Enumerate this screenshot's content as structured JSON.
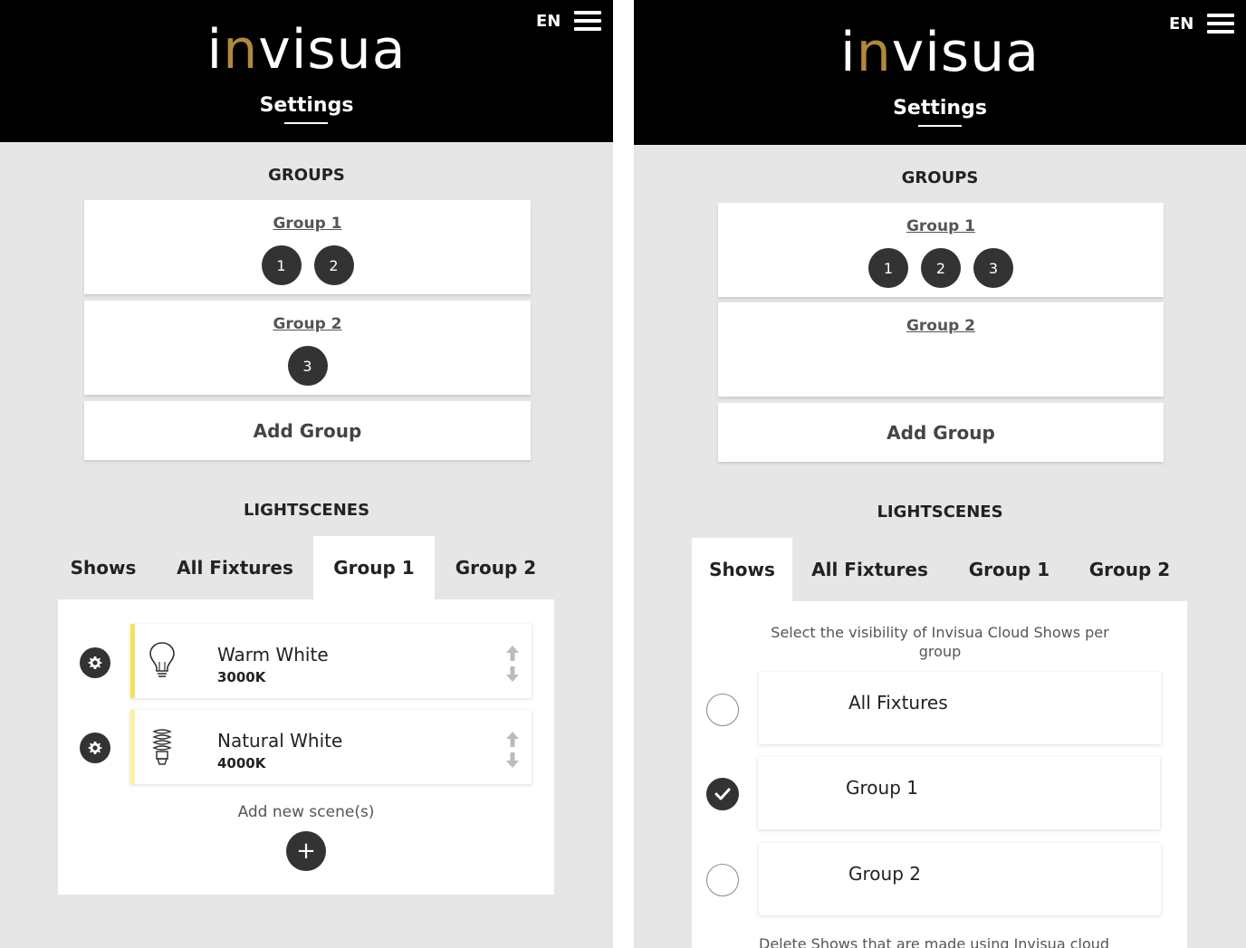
{
  "header": {
    "logo_pre": "i",
    "logo_n": "n",
    "logo_post": "visua",
    "settings": "Settings",
    "lang": "EN"
  },
  "groups_title": "GROUPS",
  "lightscenes_title": "LIGHTSCENES",
  "add_group_label": "Add Group",
  "tabs": [
    "Shows",
    "All Fixtures",
    "Group 1",
    "Group 2"
  ],
  "left": {
    "groups": [
      {
        "name": "Group 1",
        "fixtures": [
          "1",
          "2"
        ]
      },
      {
        "name": "Group 2",
        "fixtures": [
          "3"
        ]
      }
    ],
    "scenes": [
      {
        "name": "Warm White",
        "temp": "3000K",
        "color": "#f6e25b"
      },
      {
        "name": "Natural White",
        "temp": "4000K",
        "color": "#fbf0a0"
      }
    ],
    "add_scene_label": "Add new scene(s)",
    "add_button": "+"
  },
  "right": {
    "groups": [
      {
        "name": "Group 1",
        "fixtures": [
          "1",
          "2",
          "3"
        ]
      },
      {
        "name": "Group 2",
        "fixtures": []
      }
    ],
    "visibility_info": "Select the visibility of Invisua Cloud Shows per group",
    "visibility_options": [
      {
        "label": "All Fixtures",
        "checked": false
      },
      {
        "label": "Group 1",
        "checked": true
      },
      {
        "label": "Group 2",
        "checked": false
      }
    ],
    "bottom_text": "Delete Shows that are made using Invisua cloud"
  }
}
